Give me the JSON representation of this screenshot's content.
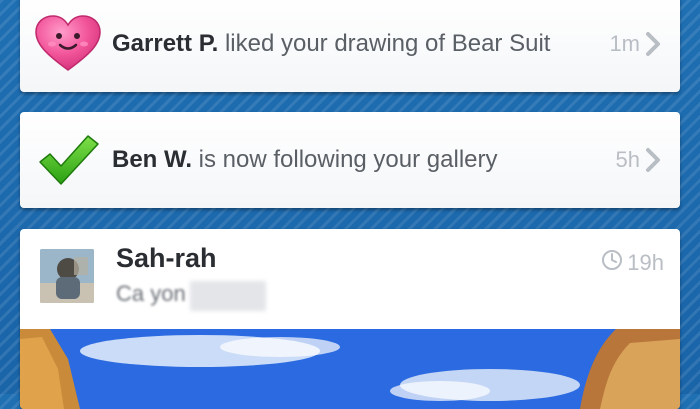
{
  "notifications": [
    {
      "icon": "heart-icon",
      "name": "Garrett P.",
      "message": " liked your drawing of Bear Suit",
      "time": "1m"
    },
    {
      "icon": "checkmark-icon",
      "name": "Ben W.",
      "message": " is now following your gallery",
      "time": "5h"
    }
  ],
  "post": {
    "author": "Sah-rah",
    "caption": "Ca yon",
    "time": "19h",
    "time_icon": "clock-icon"
  },
  "colors": {
    "background": "#1f6fb3",
    "card": "#ffffff",
    "name_text": "#2a2d32",
    "body_text": "#5a5f66",
    "muted_text": "#b9bec4",
    "heart": "#f2559a",
    "check": "#3cbf1e"
  }
}
